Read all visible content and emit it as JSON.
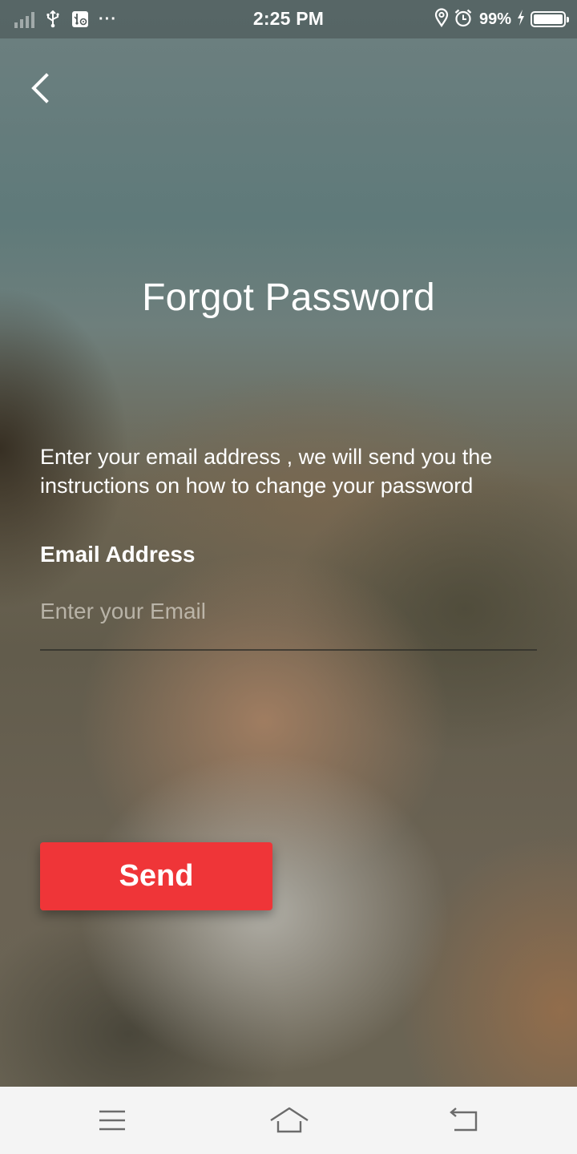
{
  "status_bar": {
    "time": "2:25 PM",
    "battery_percent": "99%",
    "battery_level": 0.99,
    "icons": [
      "signal-icon",
      "usb-icon",
      "usb-debug-icon",
      "more-dots-icon",
      "location-icon",
      "alarm-icon",
      "charging-icon",
      "battery-icon"
    ],
    "more_dots": "···"
  },
  "header": {
    "back_icon": "chevron-left-icon"
  },
  "main": {
    "title": "Forgot Password",
    "description": "Enter your email address , we will send you the instructions on how to change your password",
    "email_label": "Email Address",
    "email_placeholder": "Enter your Email",
    "email_value": "",
    "send_label": "Send"
  },
  "nav_bar": {
    "icons": [
      "menu-icon",
      "home-icon",
      "back-icon"
    ]
  },
  "colors": {
    "accent": "#ef3538",
    "text": "#ffffff",
    "navbar_bg": "#f4f4f4",
    "navbar_icon": "#6b6b6b"
  }
}
